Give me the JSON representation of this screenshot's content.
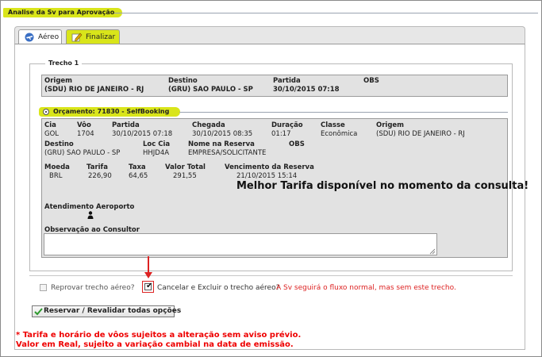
{
  "page": {
    "title": "Analise da Sv para Aprovação"
  },
  "tabs": [
    {
      "label": "Aéreo",
      "active": true
    },
    {
      "label": "Finalizar",
      "active": false
    }
  ],
  "trecho": {
    "legend": "Trecho 1",
    "labels": {
      "origem": "Origem",
      "destino": "Destino",
      "partida": "Partida",
      "obs": "OBS"
    },
    "origem": "(SDU) RIO DE JANEIRO - RJ",
    "destino": "(GRU) SAO PAULO - SP",
    "partida": "30/10/2015 07:18"
  },
  "orcamento": {
    "label": "Orçamento: 71830 - SelfBooking",
    "labels": {
      "cia": "Cia",
      "voo": "Vôo",
      "partida": "Partida",
      "chegada": "Chegada",
      "duracao": "Duração",
      "classe": "Classe",
      "origem": "Origem",
      "destino": "Destino",
      "loc_cia": "Loc Cia",
      "nome_reserva": "Nome na Reserva",
      "obs": "OBS",
      "moeda": "Moeda",
      "tarifa": "Tarifa",
      "taxa": "Taxa",
      "valor_total": "Valor Total",
      "vencimento": "Vencimento da Reserva",
      "atendimento": "Atendimento Aeroporto",
      "observacao": "Observação ao Consultor"
    },
    "cia": "GOL",
    "voo": "1704",
    "partida": "30/10/2015 07:18",
    "chegada": "30/10/2015 08:35",
    "duracao": "01:17",
    "classe": "Econômica",
    "origem": "(SDU) RIO DE JANEIRO - RJ",
    "destino": "(GRU) SAO PAULO - SP",
    "loc_cia": "HHJD4A",
    "nome_reserva": "EMPRESA/SOLICITANTE",
    "moeda": "BRL",
    "tarifa": "226,90",
    "taxa": "64,65",
    "valor_total": "291,55",
    "vencimento": "21/10/2015 15:14",
    "best_fare": "Melhor Tarifa disponível no momento da consulta!",
    "observacao_value": ""
  },
  "options": {
    "reprovar_label": "Reprovar trecho aéreo?",
    "reprovar_checked": false,
    "cancelar_label": "Cancelar e Excluir o trecho aéreo?",
    "cancelar_checked": true,
    "cancelar_note": "A Sv seguirá o fluxo normal, mas sem este trecho."
  },
  "actions": {
    "reservar_label": "Reservar / Revalidar todas opções"
  },
  "notes": {
    "line1": "* Tarifa e horário de vôos sujeitos a alteração sem aviso prévio.",
    "line2": "Valor em Real, sujeito a variação cambial na data de emissão."
  },
  "colors": {
    "accent": "#d9e51a",
    "warning": "#e00000",
    "panel": "#e2e2e2"
  },
  "icons": {
    "aereo_tab": "airplane-icon",
    "finalizar_tab": "edit-icon",
    "atendimento": "person-icon",
    "reservar": "checkmark-icon"
  }
}
